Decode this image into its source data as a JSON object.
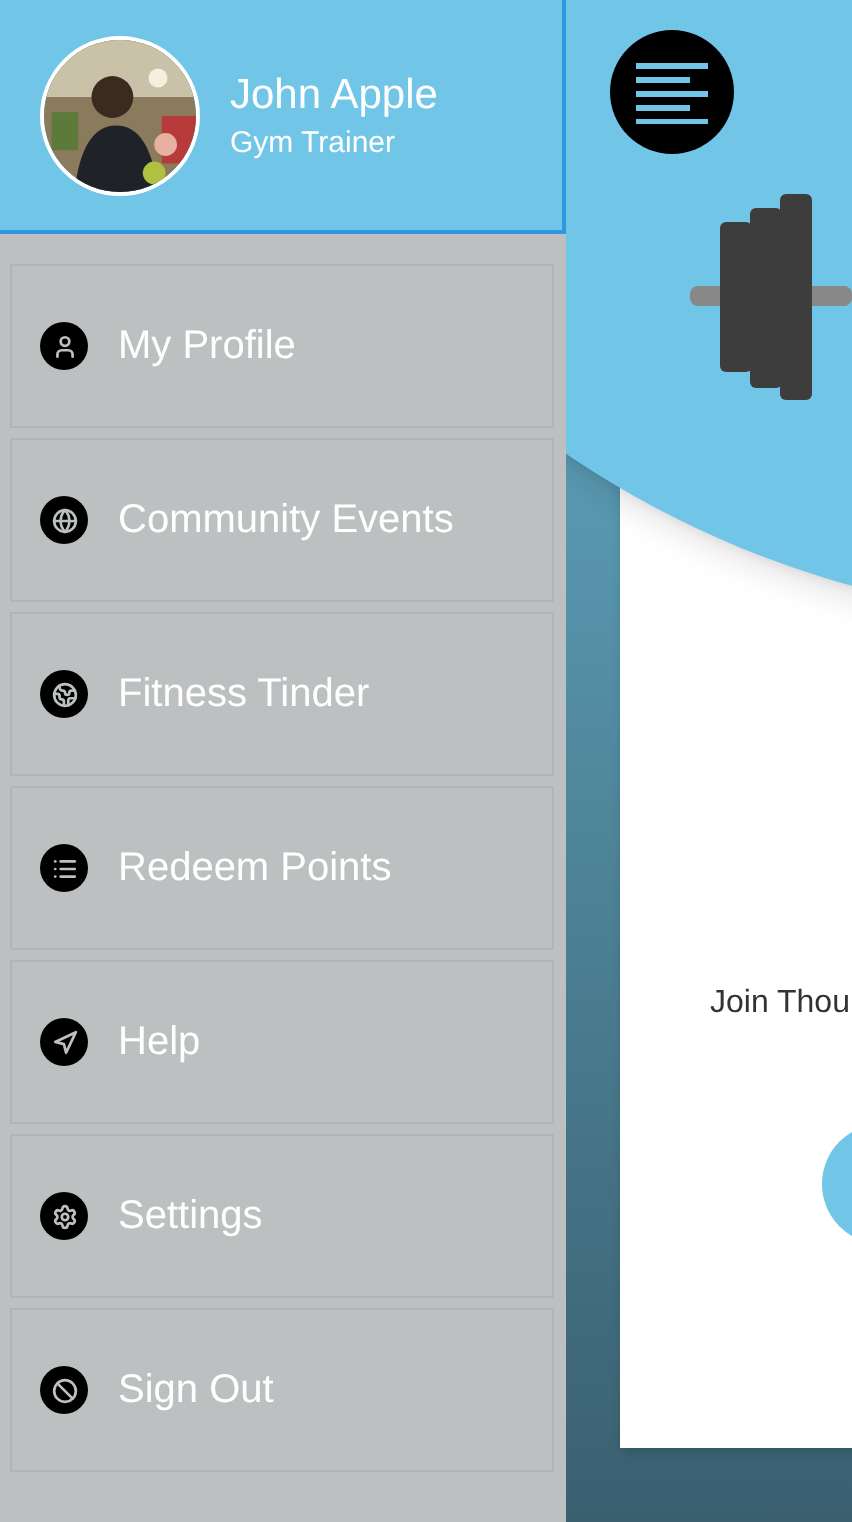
{
  "profile": {
    "name": "John Apple",
    "role": "Gym Trainer"
  },
  "menu": [
    {
      "label": "My Profile"
    },
    {
      "label": "Community Events"
    },
    {
      "label": "Fitness Tinder"
    },
    {
      "label": "Redeem Points"
    },
    {
      "label": "Help"
    },
    {
      "label": "Settings"
    },
    {
      "label": "Sign Out"
    }
  ],
  "main": {
    "subtitle": "Join Thou"
  }
}
